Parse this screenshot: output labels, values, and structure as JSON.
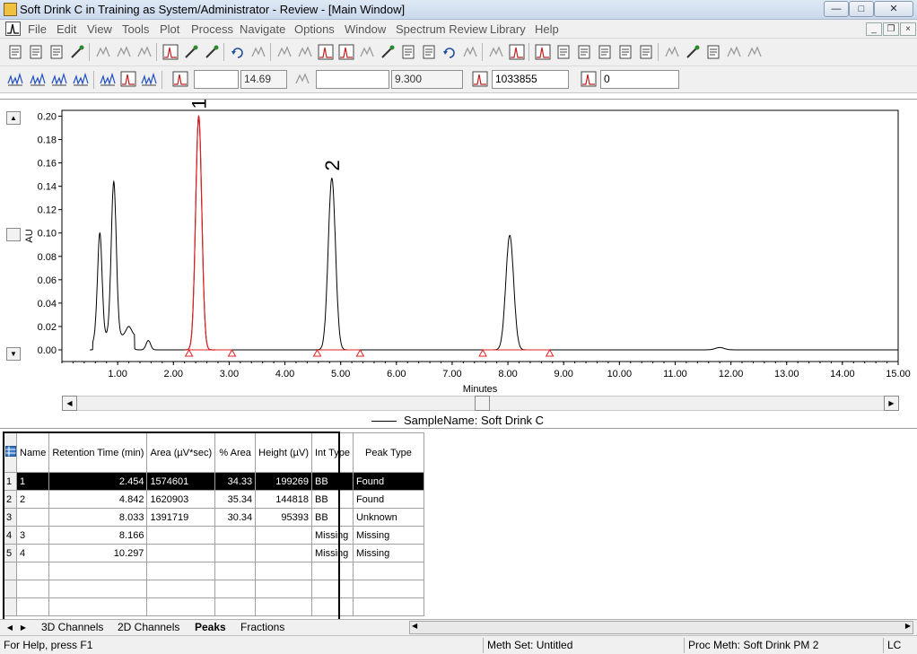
{
  "window": {
    "title": "Soft Drink C in Training as System/Administrator - Review - [Main Window]",
    "controls": [
      "minimize",
      "maximize",
      "close"
    ]
  },
  "menu": {
    "items": [
      "File",
      "Edit",
      "View",
      "Tools",
      "Plot",
      "Process",
      "Navigate",
      "Options",
      "Window",
      "Spectrum Review",
      "Library",
      "Help"
    ]
  },
  "toolbar2": {
    "field1_value": "",
    "field2_value": "14.69",
    "field3_value": "",
    "field4_value": "9.300",
    "field5_value": "1033855",
    "field6_value": "0"
  },
  "chart_data": {
    "type": "line",
    "ylabel": "AU",
    "xlabel": "Minutes",
    "xlim": [
      0.0,
      15.0
    ],
    "ylim": [
      -0.01,
      0.205
    ],
    "xticks": [
      "1.00",
      "2.00",
      "3.00",
      "4.00",
      "5.00",
      "6.00",
      "7.00",
      "8.00",
      "9.00",
      "10.00",
      "11.00",
      "12.00",
      "13.00",
      "14.00",
      "15.00"
    ],
    "xtick_values": [
      1,
      2,
      3,
      4,
      5,
      6,
      7,
      8,
      9,
      10,
      11,
      12,
      13,
      14,
      15
    ],
    "yticks": [
      "0.00",
      "0.02",
      "0.04",
      "0.06",
      "0.08",
      "0.10",
      "0.12",
      "0.14",
      "0.16",
      "0.18",
      "0.20"
    ],
    "ytick_values": [
      0.0,
      0.02,
      0.04,
      0.06,
      0.08,
      0.1,
      0.12,
      0.14,
      0.16,
      0.18,
      0.2
    ],
    "legend": "SampleName: Soft Drink C",
    "peak_labels": [
      {
        "label": "1",
        "x": 2.454
      },
      {
        "label": "2",
        "x": 4.842
      }
    ],
    "peaks": [
      {
        "rt": 0.68,
        "height": 0.088,
        "width": 0.04
      },
      {
        "rt": 0.93,
        "height": 0.132,
        "width": 0.045
      },
      {
        "rt": 1.2,
        "height": 0.008,
        "width": 0.05
      },
      {
        "rt": 1.55,
        "height": 0.008,
        "width": 0.04
      },
      {
        "rt": 2.454,
        "height": 0.2,
        "width": 0.055,
        "color": "#e02020"
      },
      {
        "rt": 4.842,
        "height": 0.147,
        "width": 0.065
      },
      {
        "rt": 8.033,
        "height": 0.098,
        "width": 0.07
      },
      {
        "rt": 11.8,
        "height": 0.002,
        "width": 0.08
      }
    ],
    "baseline_markers": [
      2.28,
      3.05,
      4.58,
      5.35,
      7.55,
      8.75
    ],
    "marker_color": "#e02020"
  },
  "peaks_table": {
    "corner_icon": "grid-icon",
    "headers": [
      "Name",
      "Retention Time (min)",
      "Area (µV*sec)",
      "% Area",
      "Height (µV)",
      "Int Type",
      "Peak Type"
    ],
    "rows": [
      {
        "row": "1",
        "name": "1",
        "rt": "2.454",
        "area": "1574601",
        "pct": "34.33",
        "height": "199269",
        "int": "BB",
        "peak": "Found",
        "selected": true
      },
      {
        "row": "2",
        "name": "2",
        "rt": "4.842",
        "area": "1620903",
        "pct": "35.34",
        "height": "144818",
        "int": "BB",
        "peak": "Found"
      },
      {
        "row": "3",
        "name": "",
        "rt": "8.033",
        "area": "1391719",
        "pct": "30.34",
        "height": "95393",
        "int": "BB",
        "peak": "Unknown"
      },
      {
        "row": "4",
        "name": "3",
        "rt": "8.166",
        "area": "",
        "pct": "",
        "height": "",
        "int": "Missing",
        "peak": "Missing"
      },
      {
        "row": "5",
        "name": "4",
        "rt": "10.297",
        "area": "",
        "pct": "",
        "height": "",
        "int": "Missing",
        "peak": "Missing"
      },
      {
        "row": "",
        "name": "",
        "rt": "",
        "area": "",
        "pct": "",
        "height": "",
        "int": "",
        "peak": ""
      },
      {
        "row": "",
        "name": "",
        "rt": "",
        "area": "",
        "pct": "",
        "height": "",
        "int": "",
        "peak": ""
      },
      {
        "row": "",
        "name": "",
        "rt": "",
        "area": "",
        "pct": "",
        "height": "",
        "int": "",
        "peak": ""
      }
    ]
  },
  "tabs": [
    "3D Channels",
    "2D Channels",
    "Peaks",
    "Fractions"
  ],
  "active_tab": "Peaks",
  "status": {
    "help": "For Help, press F1",
    "meth_set": "Meth Set: Untitled",
    "proc_meth": "Proc Meth: Soft Drink PM 2",
    "mode": "LC"
  }
}
